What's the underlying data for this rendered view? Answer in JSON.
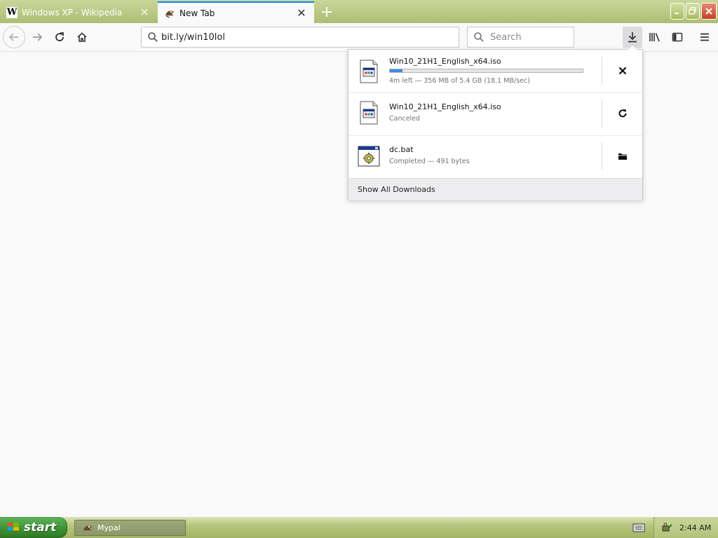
{
  "tabs": [
    {
      "title": "Windows XP - Wikipedia",
      "favicon": "wikipedia-w-icon",
      "active": false
    },
    {
      "title": "New Tab",
      "favicon": "mypal-icon",
      "active": true
    }
  ],
  "toolbar": {
    "url": "bit.ly/win10lol",
    "search_placeholder": "Search"
  },
  "downloads": {
    "items": [
      {
        "name": "Win10_21H1_English_x64.iso",
        "status": "4m left — 356 MB of 5.4 GB (18.1 MB/sec)",
        "progress": 0.066,
        "action": "cancel-icon",
        "icon": "iso-file-icon"
      },
      {
        "name": "Win10_21H1_English_x64.iso",
        "status": "Canceled",
        "action": "retry-icon",
        "icon": "iso-file-icon"
      },
      {
        "name": "dc.bat",
        "status": "Completed — 491 bytes",
        "action": "open-folder-icon",
        "icon": "batch-file-icon"
      }
    ],
    "footer_label": "Show All Downloads"
  },
  "taskbar": {
    "start_label": "start",
    "task_label": "Mypal",
    "clock": "2:44 AM"
  },
  "colors": {
    "accent_blue": "#0a84ff",
    "progress_blue": "#3a8de4",
    "xp_olive": "#aebd73",
    "start_green": "#3d8f32",
    "close_red": "#c54126"
  }
}
